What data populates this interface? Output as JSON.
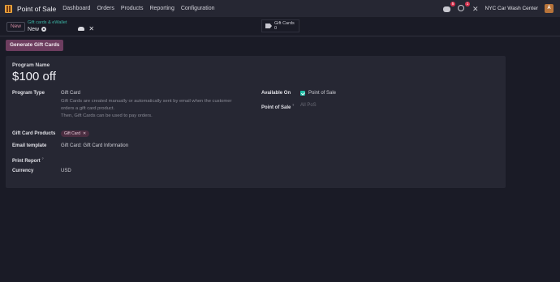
{
  "navbar": {
    "app_name": "Point of Sale",
    "menu": [
      "Dashboard",
      "Orders",
      "Products",
      "Reporting",
      "Configuration"
    ],
    "chat_badge": "5",
    "activity_badge": "1",
    "company": "NYC Car Wash Center",
    "avatar_letter": "A"
  },
  "control": {
    "new_label": "New",
    "breadcrumb_parent": "Gift cards & eWallet",
    "breadcrumb_current": "New",
    "smart_button_label": "Gift Cards",
    "smart_button_count": "0"
  },
  "status": {
    "generate_label": "Generate Gift Cards"
  },
  "form": {
    "program_name_label": "Program Name",
    "program_name": "$100 off",
    "program_type_label": "Program Type",
    "program_type_value": "Gift Card",
    "program_type_help_1": "Gift Cards are created manually or automatically sent by email when the customer",
    "program_type_help_2": "orders a gift card product.",
    "program_type_help_3": "Then, Gift Cards can be used to pay orders.",
    "available_on_label": "Available On",
    "available_on_value": "Point of Sale",
    "pos_label": "Point of Sale",
    "pos_help_mark": "?",
    "pos_placeholder": "All PoS",
    "gift_card_products_label": "Gift Card Products",
    "gift_card_product_tag": "Gift Card",
    "email_template_label": "Email template",
    "email_template_value": "Gift Card: Gift Card Information",
    "print_report_label": "Print Report",
    "print_report_help_mark": "?",
    "currency_label": "Currency",
    "currency_value": "USD"
  }
}
